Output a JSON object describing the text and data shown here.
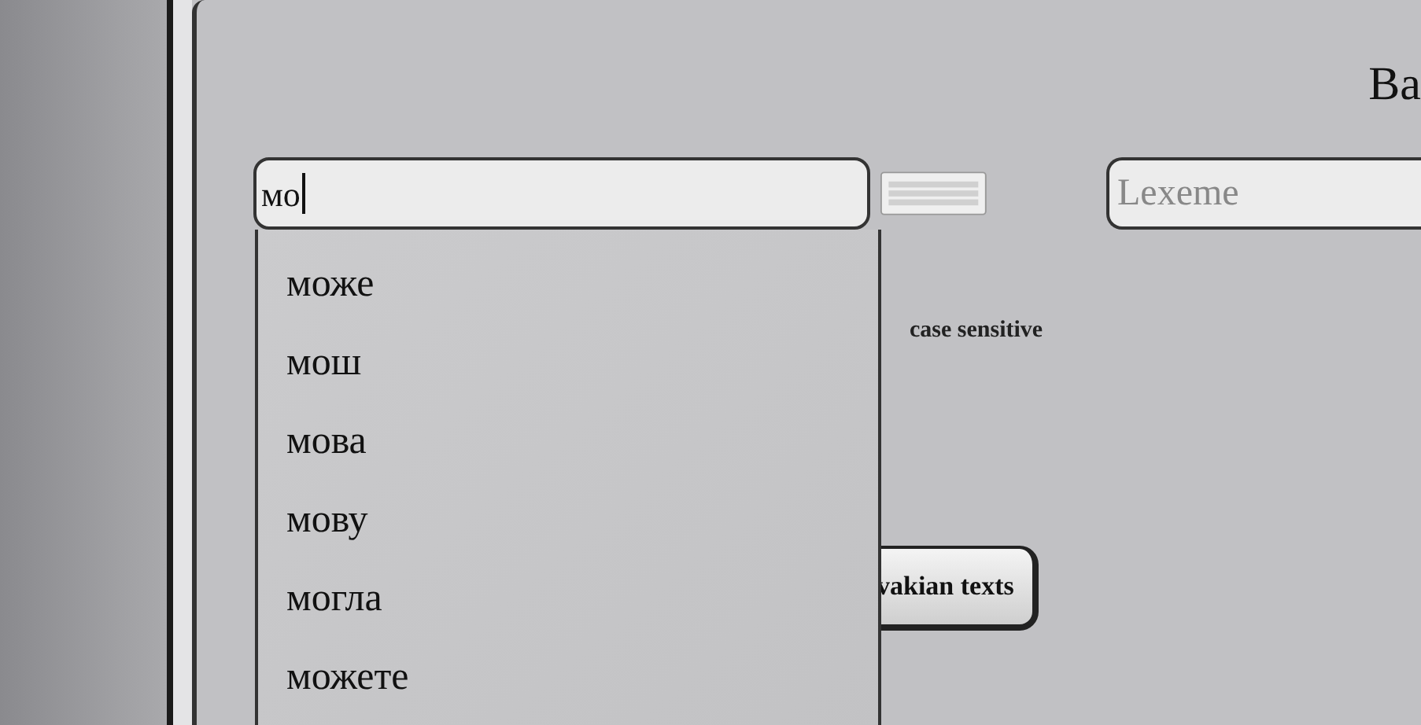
{
  "heading": "Ba",
  "search": {
    "value": "мо"
  },
  "lexeme": {
    "placeholder": "Lexeme"
  },
  "suggestions": [
    {
      "label": "може"
    },
    {
      "label": "мош"
    },
    {
      "label": "мова"
    },
    {
      "label": "мову"
    },
    {
      "label": "могла"
    },
    {
      "label": "можете"
    }
  ],
  "case_sensitive_label": "case sensitive",
  "search_button": "vakian texts"
}
